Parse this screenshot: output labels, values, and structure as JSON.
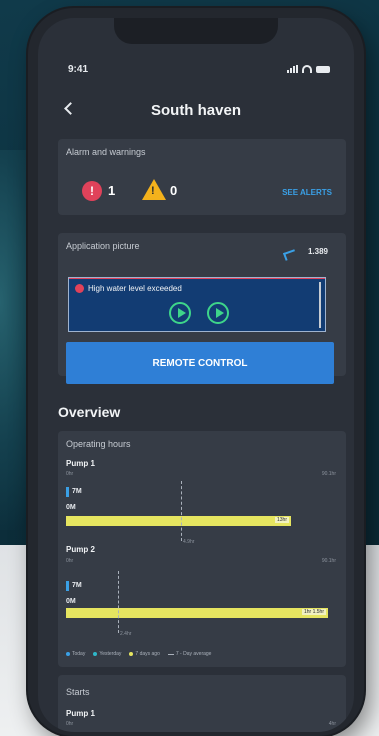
{
  "colors": {
    "accent": "#2f7fd6",
    "alarm": "#e0425a",
    "warning": "#f4b21c",
    "pump_running": "#3ed58a",
    "bar_7days": "#e6e560",
    "bar_today": "#3aa0e6"
  },
  "status_bar": {
    "time": "9:41"
  },
  "nav": {
    "back_icon": "chevron-left-icon",
    "title": "South haven"
  },
  "alarms": {
    "title": "Alarm and warnings",
    "alarm_count": "1",
    "warning_count": "0",
    "see_alerts_label": "SEE ALERTS"
  },
  "application_picture": {
    "title": "Application picture",
    "level_value": "1.389",
    "alert_text": "High water level exceeded",
    "remote_control_label": "REMOTE CONTROL"
  },
  "overview": {
    "title": "Overview",
    "operating_hours": {
      "title": "Operating hours",
      "pumps": [
        {
          "name": "Pump 1",
          "axis_min": "0hr",
          "axis_max": "90.1hr",
          "today_label": "7M",
          "yesterday_label": "0M",
          "seven_days_value": "13hr",
          "seven_days_fraction": 0.86,
          "avg_fraction": 0.44,
          "avg_label": "4.9hr"
        },
        {
          "name": "Pump 2",
          "axis_min": "0hr",
          "axis_max": "90.1hr",
          "today_label": "7M",
          "yesterday_label": "0M",
          "seven_days_value": "1hr 1.5hr",
          "seven_days_fraction": 1.0,
          "avg_fraction": 0.2,
          "avg_label": "2.4hr"
        }
      ],
      "legend": [
        "Today",
        "Yesterday",
        "7 days ago",
        "7 - Day average"
      ]
    },
    "starts": {
      "title": "Starts",
      "pump_name": "Pump 1",
      "axis_min": "0hr",
      "axis_max": "4hr"
    }
  }
}
